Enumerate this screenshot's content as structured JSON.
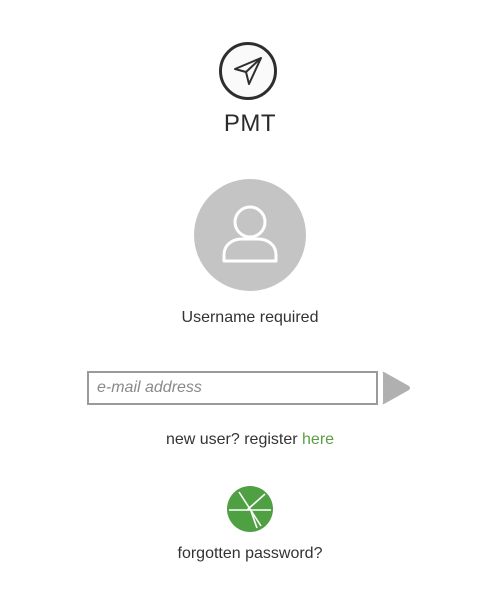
{
  "app": {
    "name": "PMT",
    "logo_icon": "paper-plane-icon"
  },
  "user": {
    "avatar_icon": "user-avatar-icon",
    "status_text": "Username required"
  },
  "login": {
    "email_placeholder": "e-mail address",
    "email_value": "",
    "submit_icon": "play-arrow-icon"
  },
  "register": {
    "prompt": "new user? register ",
    "link_text": "here"
  },
  "forgot": {
    "icon": "broken-key-circle-icon",
    "text": "forgotten password?"
  },
  "colors": {
    "accent_green": "#5a9e45",
    "avatar_gray": "#c4c4c4",
    "arrow_gray": "#b0b0b0",
    "border_gray": "#9a9a9a"
  }
}
